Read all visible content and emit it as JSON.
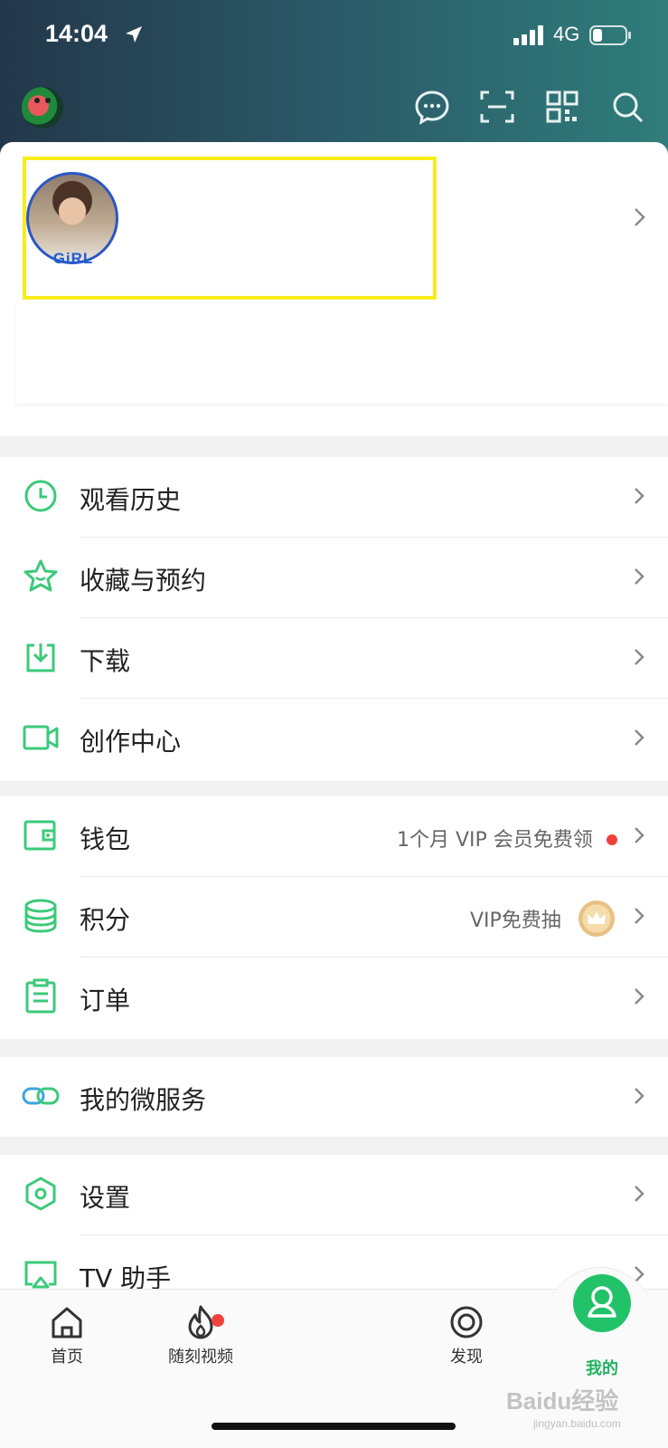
{
  "status_bar": {
    "time": "14:04",
    "network": "4G"
  },
  "profile": {
    "avatar_caption": "GiRL"
  },
  "menu_group_1": [
    {
      "label": "观看历史",
      "icon": "clock-icon"
    },
    {
      "label": "收藏与预约",
      "icon": "star-icon"
    },
    {
      "label": "下载",
      "icon": "download-icon"
    },
    {
      "label": "创作中心",
      "icon": "video-camera-icon"
    }
  ],
  "menu_group_2": [
    {
      "label": "钱包",
      "icon": "wallet-icon",
      "extra": "1个月 VIP 会员免费领"
    },
    {
      "label": "积分",
      "icon": "coins-stack-icon",
      "extra": "VIP免费抽"
    },
    {
      "label": "订单",
      "icon": "order-clipboard-icon"
    }
  ],
  "menu_group_3": [
    {
      "label": "我的微服务",
      "icon": "link-icon"
    }
  ],
  "menu_group_4": [
    {
      "label": "设置",
      "icon": "settings-hexagon-icon"
    },
    {
      "label": "TV 助手",
      "icon": "tv-cast-icon"
    }
  ],
  "tabs": [
    {
      "label": "首页",
      "icon": "home-icon"
    },
    {
      "label": "随刻视频",
      "icon": "flame-icon"
    },
    {
      "label": "发现",
      "icon": "discover-icon"
    },
    {
      "label": "我的",
      "icon": "profile-icon"
    }
  ],
  "colors": {
    "accent": "#22c269",
    "header_start": "#23374a",
    "header_end": "#2f7d7a",
    "badge_red": "#f0423b"
  },
  "watermark": {
    "text": "Baidu经验",
    "sub": "jingyan.baidu.com"
  }
}
